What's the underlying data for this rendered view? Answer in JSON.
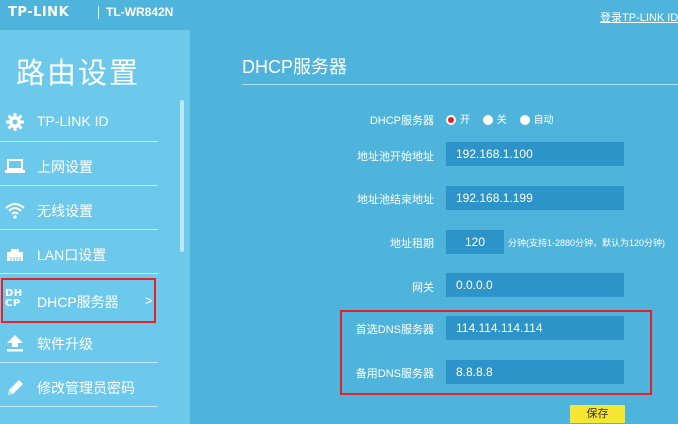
{
  "header": {
    "logo": "TP-LINK",
    "model": "TL-WR842N",
    "login_link": "登录TP-LINK ID"
  },
  "sidebar": {
    "title": "路由设置",
    "items": [
      {
        "label": "TP-LINK ID",
        "icon": "gear-icon"
      },
      {
        "label": "上网设置",
        "icon": "laptop-icon"
      },
      {
        "label": "无线设置",
        "icon": "wifi-icon"
      },
      {
        "label": "LAN口设置",
        "icon": "lan-port-icon"
      },
      {
        "label": "DHCP服务器",
        "icon": "dhcp-icon",
        "icon_text_top": "DH",
        "icon_text_bottom": "CP",
        "active": true,
        "arrow": ">"
      },
      {
        "label": "软件升级",
        "icon": "upload-icon"
      },
      {
        "label": "修改管理员密码",
        "icon": "pencil-icon"
      }
    ]
  },
  "main": {
    "title": "DHCP服务器",
    "fields": {
      "dhcp_server": {
        "label": "DHCP服务器",
        "options": [
          "开",
          "关",
          "自动"
        ],
        "selected": "开"
      },
      "pool_start": {
        "label": "地址池开始地址",
        "value": "192.168.1.100"
      },
      "pool_end": {
        "label": "地址池结束地址",
        "value": "192.168.1.199"
      },
      "lease": {
        "label": "地址租期",
        "value": "120",
        "hint": "分钟(支持1-2880分钟，默认为120分钟)"
      },
      "gateway": {
        "label": "网关",
        "value": "0.0.0.0"
      },
      "dns_primary": {
        "label": "首选DNS服务器",
        "value": "114.114.114.114"
      },
      "dns_secondary": {
        "label": "备用DNS服务器",
        "value": "8.8.8.8"
      }
    },
    "save_label": "保存"
  },
  "colors": {
    "background": "#4fb4dc",
    "sidebar": "#6dc9ec",
    "input": "#2d94c9",
    "highlight": "#e8202a",
    "save_button": "#f5e631"
  }
}
